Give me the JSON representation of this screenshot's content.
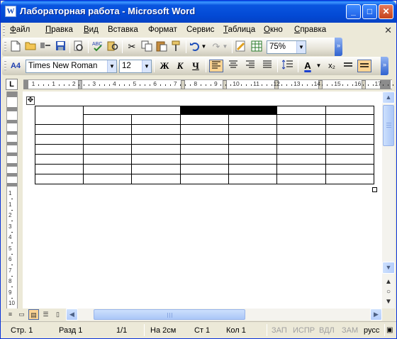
{
  "window": {
    "title": "Лабораторная работа - Microsoft Word",
    "app_icon": "W",
    "minimize": "_",
    "maximize": "□",
    "close": "✕"
  },
  "menu": {
    "items": [
      {
        "label": "Файл",
        "accel": "Ф",
        "rest": "айл"
      },
      {
        "label": "Правка",
        "accel": "П",
        "rest": "равка"
      },
      {
        "label": "Вид",
        "accel": "В",
        "rest": "ид"
      },
      {
        "label": "Вставка",
        "accel": "",
        "rest": "Вставка"
      },
      {
        "label": "Формат",
        "accel": "",
        "rest": "Формат"
      },
      {
        "label": "Сервис",
        "accel": "",
        "rest": "Сервис"
      },
      {
        "label": "Таблица",
        "accel": "Т",
        "rest": "аблица"
      },
      {
        "label": "Окно",
        "accel": "О",
        "rest": "кно"
      },
      {
        "label": "Справка",
        "accel": "С",
        "rest": "правка"
      }
    ],
    "close_doc": "✕"
  },
  "standard_toolbar": {
    "zoom": "75%"
  },
  "formatting_toolbar": {
    "style_glyph": "A4",
    "font_name": "Times New Roman",
    "font_size": "12",
    "bold": "Ж",
    "italic": "К",
    "underline": "Ч",
    "font_color_glyph": "A",
    "font_color": "#1a3fd0",
    "subscript": "x₂",
    "accent_color": "#fdd493"
  },
  "ruler": {
    "tab_selector": "L",
    "numbers": [
      "1",
      "1",
      "2",
      "3",
      "4",
      "5",
      "6",
      "7",
      "8",
      "9",
      "10",
      "11",
      "12",
      "13",
      "14",
      "15",
      "16",
      "17"
    ],
    "vertical_numbers": [
      "1",
      "1",
      "2",
      "3",
      "4",
      "5",
      "6",
      "7",
      "8",
      "9",
      "10"
    ]
  },
  "table": {
    "rows": 8,
    "cols": 7,
    "black_cell_label": "selected merged header cells"
  },
  "statusbar": {
    "page": "Стр. 1",
    "section": "Разд 1",
    "pages": "1/1",
    "at": "На 2см",
    "line": "Ст 1",
    "col": "Кол 1",
    "rec": "ЗАП",
    "trk": "ИСПР",
    "ext": "ВДЛ",
    "ovr": "ЗАМ",
    "lang": "русс"
  }
}
